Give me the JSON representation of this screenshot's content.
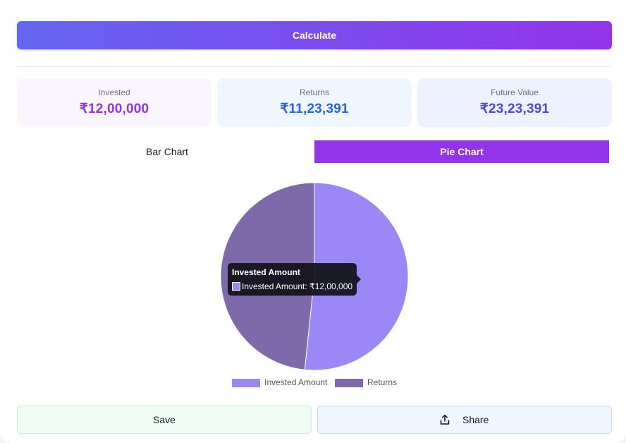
{
  "calculate_label": "Calculate",
  "stats": [
    {
      "label": "Invested",
      "value": "₹12,00,000",
      "bg": "#faf5ff",
      "color": "#9333ea"
    },
    {
      "label": "Returns",
      "value": "₹11,23,391",
      "bg": "#eff6ff",
      "color": "#2563eb"
    },
    {
      "label": "Future Value",
      "value": "₹23,23,391",
      "bg": "#eef2ff",
      "color": "#4f46e5"
    }
  ],
  "tabs": {
    "bar": "Bar Chart",
    "pie": "Pie Chart",
    "active": "pie"
  },
  "chart_data": {
    "type": "pie",
    "labels": [
      "Invested Amount",
      "Returns"
    ],
    "values": [
      1200000,
      1123391
    ],
    "colors": [
      "#9b87f5",
      "#7e69ab"
    ],
    "legend_position": "bottom"
  },
  "tooltip": {
    "title": "Invested Amount",
    "line": "Invested Amount: ₹12,00,000"
  },
  "legend": [
    {
      "label": "Invested Amount",
      "color": "#9b87f5"
    },
    {
      "label": "Returns",
      "color": "#7e69ab"
    }
  ],
  "actions": {
    "save": "Save",
    "share": "Share"
  },
  "icons": {
    "share": "share-upload-icon"
  }
}
